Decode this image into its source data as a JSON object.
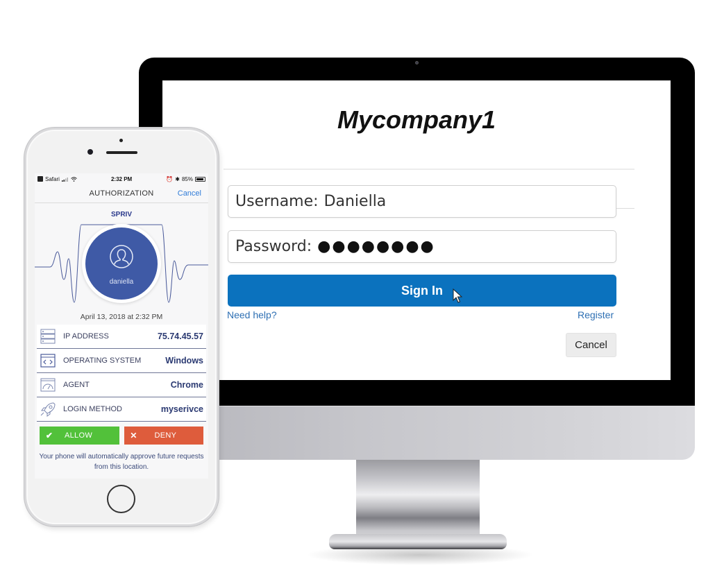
{
  "monitor": {
    "login_page": {
      "company_name": "Mycompany1",
      "username_label": "Username:",
      "username_value": "Daniella",
      "password_label": "Password:",
      "password_value": "●●●●●●●●",
      "sign_in_label": "Sign In",
      "need_help_label": "Need help?",
      "register_label": "Register",
      "cancel_label": "Cancel",
      "accent_color": "#0b72be"
    }
  },
  "phone": {
    "status_bar": {
      "carrier": "Safari",
      "time": "2:32 PM",
      "battery": "85%"
    },
    "nav": {
      "title": "AUTHORIZATION",
      "cancel_label": "Cancel"
    },
    "brand": "SPRIV",
    "user": {
      "name": "daniella",
      "avatar_icon": "user-icon"
    },
    "timestamp": "April 13, 2018 at 2:32 PM",
    "details": [
      {
        "icon": "server-icon",
        "label": "IP ADDRESS",
        "value": "75.74.45.57"
      },
      {
        "icon": "code-window-icon",
        "label": "OPERATING SYSTEM",
        "value": "Windows"
      },
      {
        "icon": "speedometer-icon",
        "label": "AGENT",
        "value": "Chrome"
      },
      {
        "icon": "rocket-icon",
        "label": "LOGIN METHOD",
        "value": "myserivce"
      }
    ],
    "actions": {
      "allow_label": "ALLOW",
      "allow_glyph": "✔",
      "allow_color": "#52c13a",
      "deny_label": "DENY",
      "deny_glyph": "✕",
      "deny_color": "#de5c3c"
    },
    "footnote": "Your phone will automatically approve future requests from this location."
  }
}
